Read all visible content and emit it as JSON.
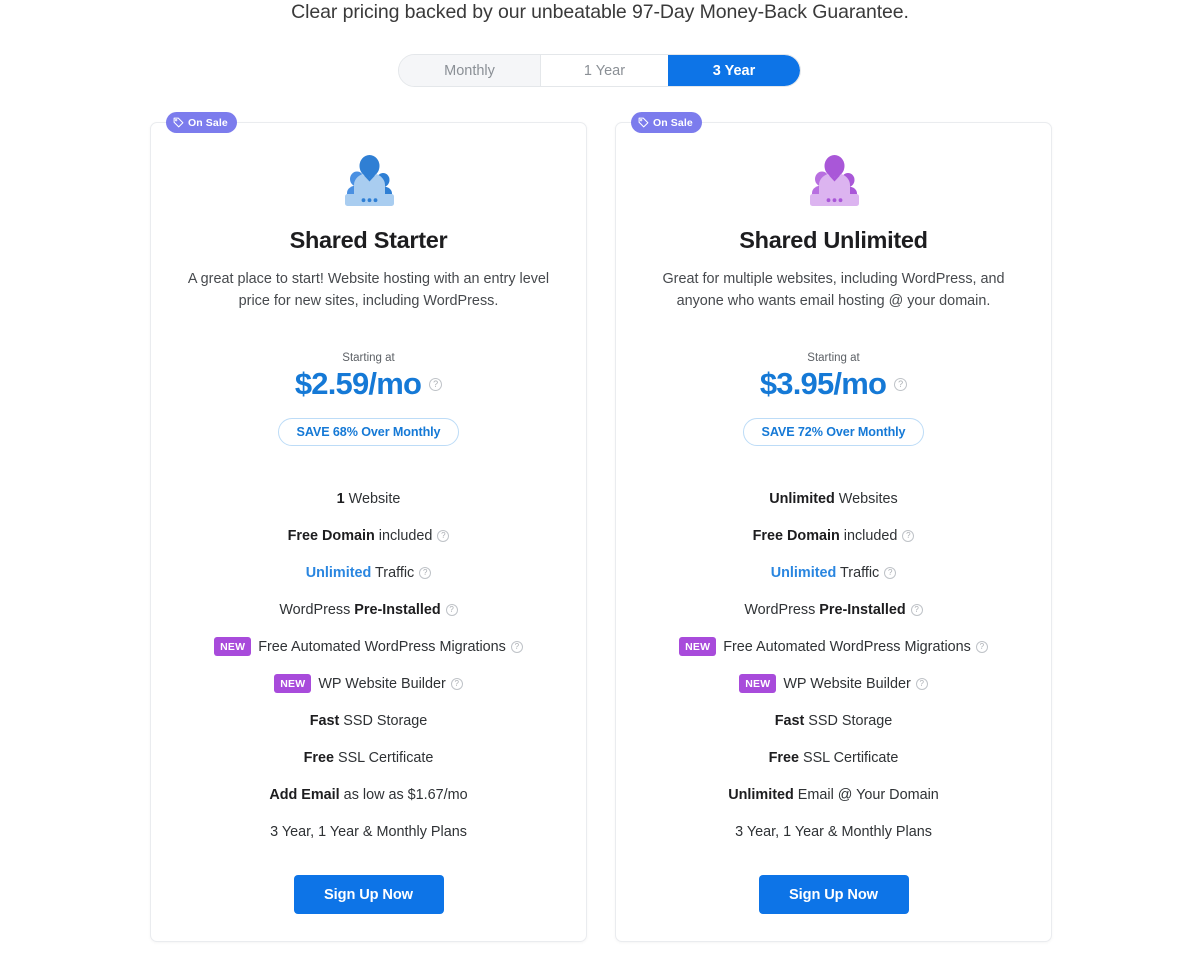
{
  "headline": "Clear pricing backed by our unbeatable 97-Day Money-Back Guarantee.",
  "billing_toggle": {
    "options": [
      {
        "label": "Monthly",
        "active": false
      },
      {
        "label": "1 Year",
        "active": false
      },
      {
        "label": "3 Year",
        "active": true
      }
    ]
  },
  "colors": {
    "primary_blue": "#0d74e7",
    "price_blue": "#1579d6",
    "sale_purple": "#7c7ced",
    "new_purple": "#a84bdb",
    "icon_blue": "#3b82d9",
    "icon_purple": "#b06fdf"
  },
  "plans": [
    {
      "badge": "On Sale",
      "icon": "people-group-icon",
      "name": "Shared Starter",
      "description": "A great place to start! Website hosting with an entry level price for new sites, including WordPress.",
      "starting_at_label": "Starting at",
      "price": "$2.59/mo",
      "save_label": "SAVE 68% Over Monthly",
      "features": [
        {
          "bold": "1",
          "text": " Website",
          "help": false
        },
        {
          "bold": "Free Domain",
          "text": " included",
          "help": true
        },
        {
          "blue": "Unlimited",
          "text": " Traffic",
          "help": true
        },
        {
          "text": "WordPress ",
          "bold_after": "Pre-Installed",
          "help": true
        },
        {
          "new": "NEW",
          "text": "Free Automated WordPress Migrations",
          "help": true
        },
        {
          "new": "NEW",
          "text": "WP Website Builder",
          "help": true
        },
        {
          "bold": "Fast",
          "text": " SSD Storage",
          "help": false
        },
        {
          "bold": "Free",
          "text": " SSL Certificate",
          "help": false
        },
        {
          "bold": "Add Email",
          "text": " as low as $1.67/mo",
          "help": false
        },
        {
          "text": "3 Year, 1 Year & Monthly Plans",
          "help": false
        }
      ],
      "cta": "Sign Up Now"
    },
    {
      "badge": "On Sale",
      "icon": "people-group-icon",
      "name": "Shared Unlimited",
      "description": "Great for multiple websites, including WordPress, and anyone who wants email hosting @ your domain.",
      "starting_at_label": "Starting at",
      "price": "$3.95/mo",
      "save_label": "SAVE 72% Over Monthly",
      "features": [
        {
          "bold": "Unlimited",
          "text": " Websites",
          "help": false
        },
        {
          "bold": "Free Domain",
          "text": " included",
          "help": true
        },
        {
          "blue": "Unlimited",
          "text": " Traffic",
          "help": true
        },
        {
          "text": "WordPress ",
          "bold_after": "Pre-Installed",
          "help": true
        },
        {
          "new": "NEW",
          "text": "Free Automated WordPress Migrations",
          "help": true
        },
        {
          "new": "NEW",
          "text": "WP Website Builder",
          "help": true
        },
        {
          "bold": "Fast",
          "text": " SSD Storage",
          "help": false
        },
        {
          "bold": "Free",
          "text": " SSL Certificate",
          "help": false
        },
        {
          "bold": "Unlimited",
          "text": " Email @ Your Domain",
          "help": false
        },
        {
          "text": "3 Year, 1 Year & Monthly Plans",
          "help": false
        }
      ],
      "cta": "Sign Up Now"
    }
  ],
  "icons": {
    "tag": "tag-icon",
    "help": "?"
  }
}
